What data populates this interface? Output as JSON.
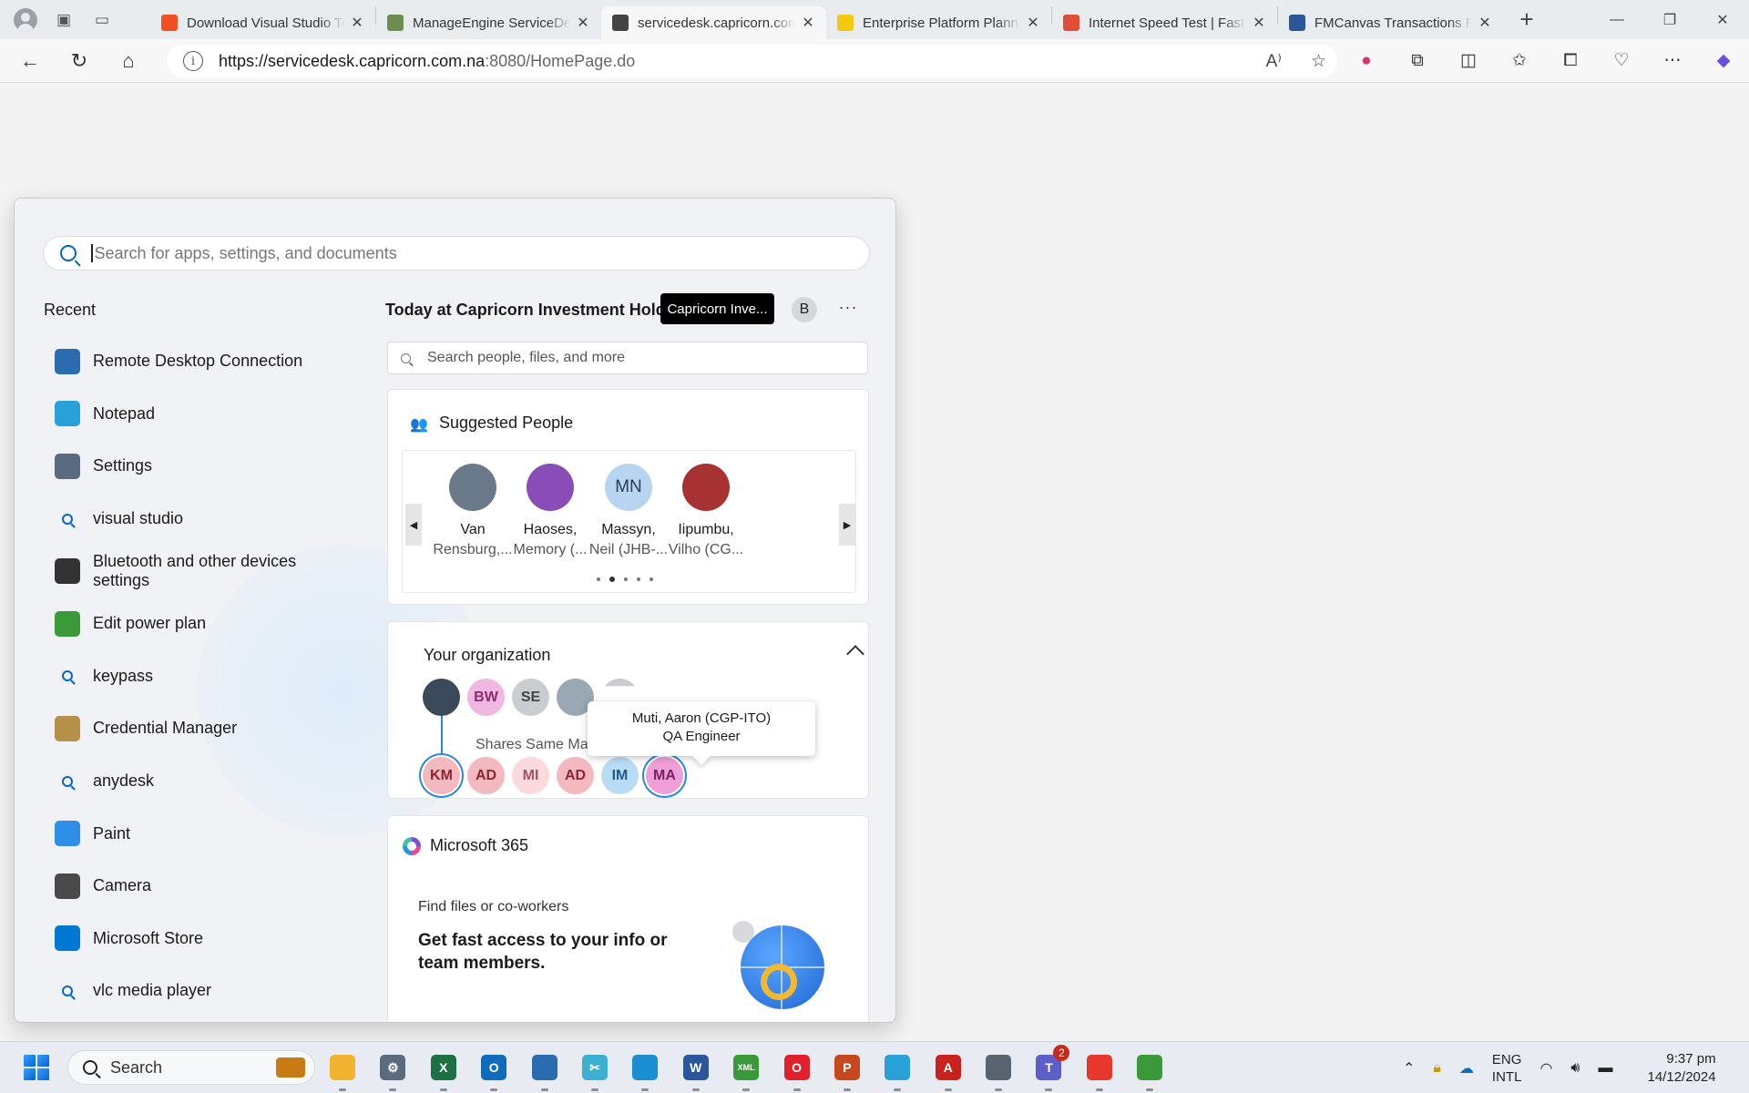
{
  "browser": {
    "tabs": [
      {
        "title": "Download Visual Studio Tools",
        "favicon_color": "#f25022"
      },
      {
        "title": "ManageEngine ServiceDesk",
        "favicon_color": "#6b8e4e"
      },
      {
        "title": "servicedesk.capricorn.com.na",
        "favicon_color": "#444444",
        "active": true
      },
      {
        "title": "Enterprise Platform Planning",
        "favicon_color": "#f2c811"
      },
      {
        "title": "Internet Speed Test | Fast.com",
        "favicon_color": "#e04e3a"
      },
      {
        "title": "FMCanvas Transactions Report",
        "favicon_color": "#2b579a"
      }
    ],
    "url_main": "https://servicedesk.capricorn.com.na",
    "url_port": ":8080/HomePage.do"
  },
  "start_menu": {
    "search_placeholder": "Search for apps, settings, and documents",
    "recent_title": "Recent",
    "recent": [
      {
        "label": "Remote Desktop Connection",
        "icon": "remote-desktop-icon",
        "color": "#2b6cb0"
      },
      {
        "label": "Notepad",
        "icon": "notepad-icon",
        "color": "#2aa0d8"
      },
      {
        "label": "Settings",
        "icon": "settings-gear-icon",
        "color": "#5a6b80"
      },
      {
        "label": "visual studio",
        "icon": "search-icon",
        "color": ""
      },
      {
        "label": "Bluetooth and other devices settings",
        "icon": "devices-icon",
        "color": "#333333"
      },
      {
        "label": "Edit power plan",
        "icon": "power-plan-icon",
        "color": "#3a9a3a"
      },
      {
        "label": "keypass",
        "icon": "search-icon",
        "color": ""
      },
      {
        "label": "Credential Manager",
        "icon": "credential-manager-icon",
        "color": "#b49048"
      },
      {
        "label": "anydesk",
        "icon": "search-icon",
        "color": ""
      },
      {
        "label": "Paint",
        "icon": "paint-icon",
        "color": "#2f8fe8"
      },
      {
        "label": "Camera",
        "icon": "camera-icon",
        "color": "#4a4a4a"
      },
      {
        "label": "Microsoft Store",
        "icon": "store-icon",
        "color": "#0078d4"
      },
      {
        "label": "vlc media player",
        "icon": "search-icon",
        "color": ""
      }
    ],
    "today_title": "Today at Capricorn Investment Holdings",
    "org_tooltip": "Capricorn Inve...",
    "profile_initial": "B",
    "more_label": "···",
    "people_search_placeholder": "Search people, files, and more",
    "suggested": {
      "title": "Suggested People",
      "people": [
        {
          "name": "Van",
          "sub": "Rensburg,...",
          "initials": "",
          "color": "#6b7a8a"
        },
        {
          "name": "Haoses,",
          "sub": "Memory (...",
          "initials": "",
          "color": "#8a4db8"
        },
        {
          "name": "Massyn,",
          "sub": "Neil (JHB-...",
          "initials": "MN",
          "color": "#b7d5f0"
        },
        {
          "name": "Iipumbu,",
          "sub": "Vilho (CG...",
          "initials": "",
          "color": "#a83232"
        }
      ]
    },
    "organization": {
      "title": "Your organization",
      "top_row": [
        {
          "initials": "",
          "color": "#3b4a5a",
          "text_color": "#ffffff"
        },
        {
          "initials": "BW",
          "color": "#f0b8e0",
          "text_color": "#8a2c6e"
        },
        {
          "initials": "SE",
          "color": "#c9cdd1",
          "text_color": "#444444"
        },
        {
          "initials": "",
          "color": "#9aa7b5",
          "text_color": "#ffffff"
        }
      ],
      "shares_label": "Shares Same Manager",
      "bottom_row": [
        {
          "initials": "KM",
          "color": "#f4b8bf",
          "text_color": "#8a2433"
        },
        {
          "initials": "AD",
          "color": "#f4b8bf",
          "text_color": "#8a2433"
        },
        {
          "initials": "MI",
          "color": "#fbd9dc",
          "text_color": "#a0555f"
        },
        {
          "initials": "AD",
          "color": "#f4b8bf",
          "text_color": "#8a2433"
        },
        {
          "initials": "IM",
          "color": "#b9dcf5",
          "text_color": "#1f5a8a"
        },
        {
          "initials": "MA",
          "color": "#ef9fd8",
          "text_color": "#7a1f63"
        }
      ],
      "hover_name": "Muti, Aaron (CGP-ITO)",
      "hover_role": "QA Engineer"
    },
    "m365": {
      "title": "Microsoft 365",
      "find_text": "Find files or co-workers",
      "headline": "Get fast access to your info or team members."
    }
  },
  "taskbar": {
    "search_label": "Search",
    "apps": [
      {
        "name": "file-explorer",
        "color": "#f2b430",
        "label": ""
      },
      {
        "name": "settings",
        "color": "#5a6b80",
        "label": "⚙"
      },
      {
        "name": "excel",
        "color": "#1d7044",
        "label": "X"
      },
      {
        "name": "outlook",
        "color": "#0f6cbd",
        "label": "O"
      },
      {
        "name": "remote-desktop",
        "color": "#2b6cb0",
        "label": ""
      },
      {
        "name": "snipping-tool",
        "color": "#3bb0d0",
        "label": "✂"
      },
      {
        "name": "edge",
        "color": "#1a8fd0",
        "label": ""
      },
      {
        "name": "word",
        "color": "#2b579a",
        "label": "W"
      },
      {
        "name": "xml-notepad",
        "color": "#3a9a3a",
        "label": "XML"
      },
      {
        "name": "opera",
        "color": "#e0202a",
        "label": "O"
      },
      {
        "name": "powerpoint",
        "color": "#c8481e",
        "label": "P"
      },
      {
        "name": "notepad",
        "color": "#2aa0d8",
        "label": ""
      },
      {
        "name": "acrobat",
        "color": "#c8211e",
        "label": "A"
      },
      {
        "name": "calculator",
        "color": "#5a6470",
        "label": ""
      },
      {
        "name": "teams",
        "color": "#5b5fc7",
        "label": "T",
        "badge": "2"
      },
      {
        "name": "anydesk",
        "color": "#e8372d",
        "label": ""
      },
      {
        "name": "paint",
        "color": "#3a9a3a",
        "label": ""
      }
    ],
    "lang_top": "ENG",
    "lang_bottom": "INTL",
    "time": "9:37 pm",
    "date": "14/12/2024"
  }
}
